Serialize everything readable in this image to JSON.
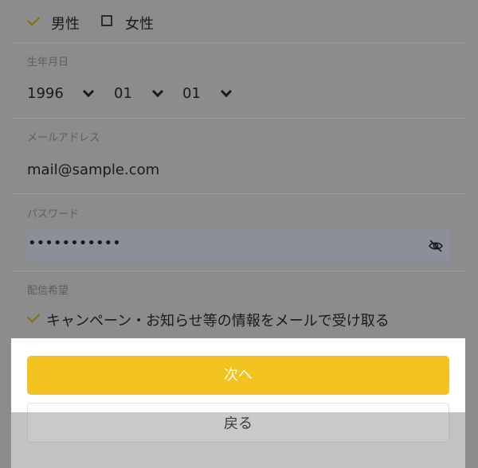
{
  "gender": {
    "male_label": "男性",
    "female_label": "女性",
    "selected": "male"
  },
  "birthdate": {
    "label": "生年月日",
    "year": "1996",
    "month": "01",
    "day": "01"
  },
  "email": {
    "label": "メールアドレス",
    "value": "mail@sample.com"
  },
  "password": {
    "label": "パスワード",
    "masked_value": "•••••••••••"
  },
  "delivery": {
    "label": "配信希望",
    "option_label": "キャンペーン・お知らせ等の情報をメールで受け取る",
    "checked": true
  },
  "actions": {
    "next_label": "次へ",
    "back_label": "戻る"
  },
  "colors": {
    "accent": "#f2c31e",
    "overlay": "#8c8c8c"
  }
}
